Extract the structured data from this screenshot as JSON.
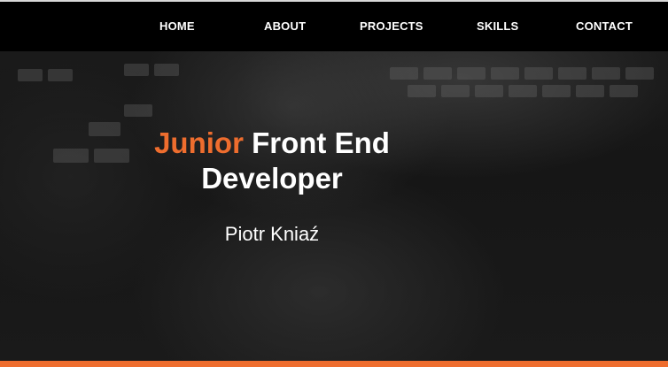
{
  "nav": {
    "items": [
      {
        "label": "HOME"
      },
      {
        "label": "ABOUT"
      },
      {
        "label": "PROJECTS"
      },
      {
        "label": "SKILLS"
      },
      {
        "label": "CONTACT"
      }
    ]
  },
  "hero": {
    "title_accent": "Junior",
    "title_rest_line1": "Front End",
    "title_line2": "Developer",
    "name": "Piotr Kniaź"
  },
  "colors": {
    "accent": "#ee6d2e",
    "navbar_bg": "#000000",
    "text": "#ffffff"
  },
  "background": {
    "image": "hands-on-keyboard-photo"
  }
}
